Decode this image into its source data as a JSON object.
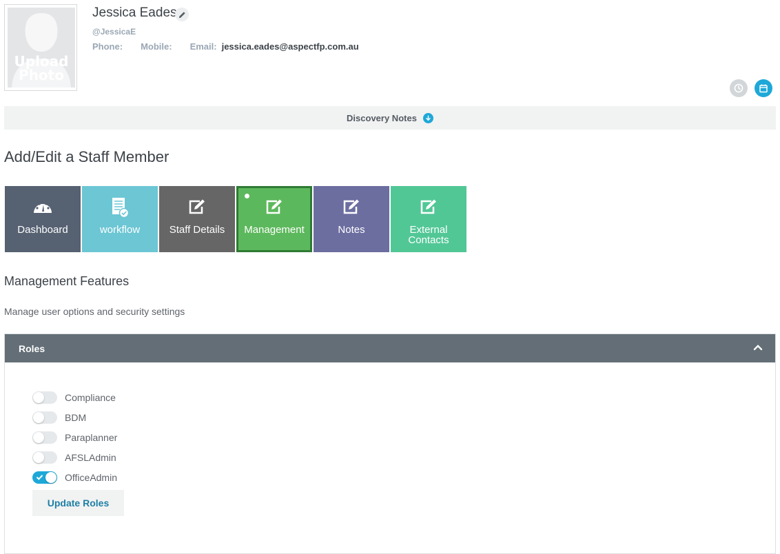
{
  "profile": {
    "photo_text_line1": "Upload",
    "photo_text_line2": "Photo",
    "name": "Jessica Eades",
    "handle": "@JessicaE",
    "phone_label": "Phone:",
    "phone_value": "",
    "mobile_label": "Mobile:",
    "mobile_value": "",
    "email_label": "Email:",
    "email_value": "jessica.eades@aspectfp.com.au"
  },
  "header_actions": {
    "history_icon": "clock-icon",
    "calendar_icon": "calendar-icon",
    "history_color": "#d3d6d9",
    "calendar_color": "#1ea8d8"
  },
  "discovery": {
    "label": "Discovery Notes",
    "icon": "arrow-down-circle-icon"
  },
  "page_title": "Add/Edit a Staff Member",
  "tiles": [
    {
      "label": "Dashboard",
      "icon": "dashboard-gauge-icon",
      "color": "#566172"
    },
    {
      "label": "workflow",
      "icon": "document-check-icon",
      "color": "#6cc6d4"
    },
    {
      "label": "Staff Details",
      "icon": "edit-icon",
      "color": "#666666"
    },
    {
      "label": "Management",
      "icon": "edit-icon",
      "color": "#5cb85c",
      "active": true
    },
    {
      "label": "Notes",
      "icon": "edit-icon",
      "color": "#6c6ea0"
    },
    {
      "label_line1": "External",
      "label_line2": "Contacts",
      "icon": "edit-icon",
      "color": "#52c796"
    }
  ],
  "management": {
    "title": "Management Features",
    "subtitle": "Manage user options and security settings"
  },
  "roles_panel": {
    "title": "Roles",
    "roles": [
      {
        "label": "Compliance",
        "enabled": false
      },
      {
        "label": "BDM",
        "enabled": false
      },
      {
        "label": "Paraplanner",
        "enabled": false
      },
      {
        "label": "AFSLAdmin",
        "enabled": false
      },
      {
        "label": "OfficeAdmin",
        "enabled": true
      }
    ],
    "update_button": "Update Roles"
  }
}
